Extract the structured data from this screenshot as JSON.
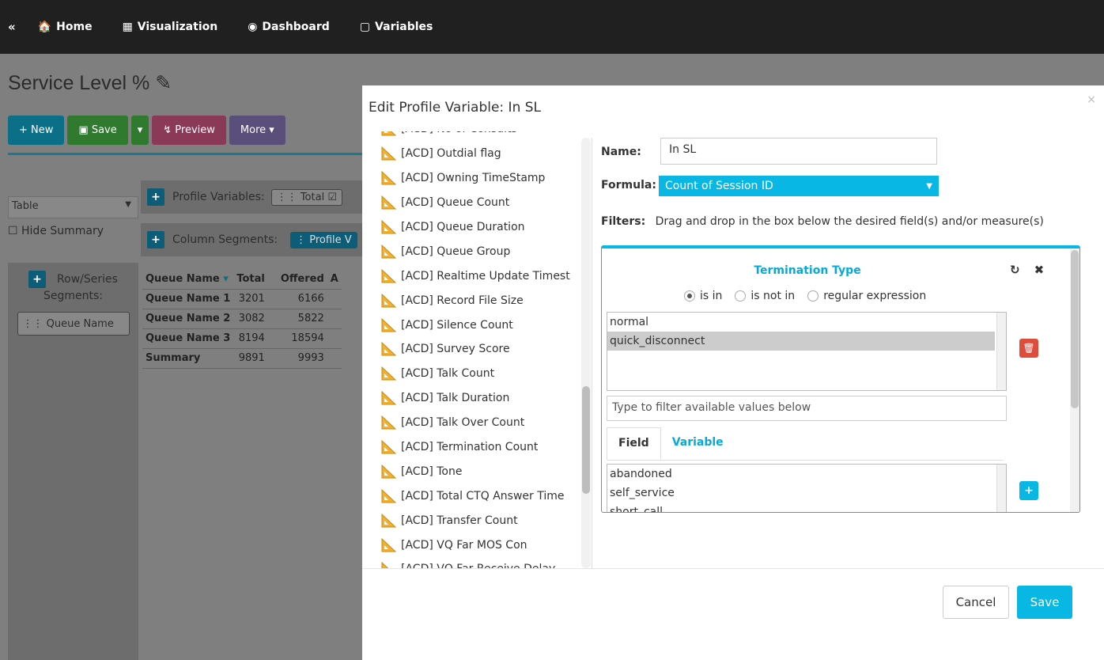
{
  "nav": {
    "collapse": "«",
    "items": [
      {
        "label": "Home",
        "icon": "home-icon"
      },
      {
        "label": "Visualization",
        "icon": "table-icon"
      },
      {
        "label": "Dashboard",
        "icon": "dashboard-icon"
      },
      {
        "label": "Variables",
        "icon": "monitor-icon"
      }
    ]
  },
  "page": {
    "title": "Service Level %",
    "toolbar": {
      "new": "New",
      "save": "Save",
      "preview": "Preview",
      "more": "More"
    },
    "view_select": "Table",
    "hide_summary": "Hide Summary",
    "profile_variables_label": "Profile Variables:",
    "profile_variables_pill": "Total",
    "column_segments_label": "Column Segments:",
    "column_segments_pill": "Profile V",
    "row_series_label": "Row/Series",
    "row_series_label2": "Segments:",
    "row_series_pill": "Queue Name",
    "table": {
      "headers": [
        "Queue Name",
        "Total",
        "Offered",
        "A"
      ],
      "rows": [
        [
          "Queue Name 1",
          "3201",
          "6166"
        ],
        [
          "Queue Name 2",
          "3082",
          "5822"
        ],
        [
          "Queue Name 3",
          "8194",
          "18594"
        ],
        [
          "Summary",
          "9891",
          "9993"
        ]
      ]
    }
  },
  "modal": {
    "title": "Edit Profile Variable: In SL",
    "close": "×",
    "fields": [
      "[ACD] No of Consults",
      "[ACD] Outdial flag",
      "[ACD] Owning TimeStamp",
      "[ACD] Queue Count",
      "[ACD] Queue Duration",
      "[ACD] Queue Group",
      "[ACD] Realtime Update Timest",
      "[ACD] Record File Size",
      "[ACD] Silence Count",
      "[ACD] Survey Score",
      "[ACD] Talk Count",
      "[ACD] Talk Duration",
      "[ACD] Talk Over Count",
      "[ACD] Termination Count",
      "[ACD] Tone",
      "[ACD] Total CTQ Answer Time",
      "[ACD] Transfer Count",
      "[ACD] VQ Far MOS Con",
      "[ACD] VQ Far Receive Delay"
    ],
    "name_label": "Name:",
    "name_value": "In SL",
    "formula_label": "Formula:",
    "formula_value": "Count of Session ID",
    "filters_label": "Filters:",
    "filters_hint": "Drag and drop in the box below the desired field(s) and/or measure(s)",
    "filter": {
      "title": "Termination Type",
      "radio_is_in": "is in",
      "radio_is_not_in": "is not in",
      "radio_regex": "regular expression",
      "selected_values": [
        "normal",
        "quick_disconnect"
      ],
      "type_filter_placeholder": "Type to filter available values below",
      "tab_field": "Field",
      "tab_variable": "Variable",
      "available_values": [
        "abandoned",
        "self_service",
        "short_call"
      ]
    },
    "cancel": "Cancel",
    "save": "Save"
  },
  "colors": {
    "accent": "#08b7e4",
    "danger": "#e04c3c",
    "navbar": "#202020"
  }
}
